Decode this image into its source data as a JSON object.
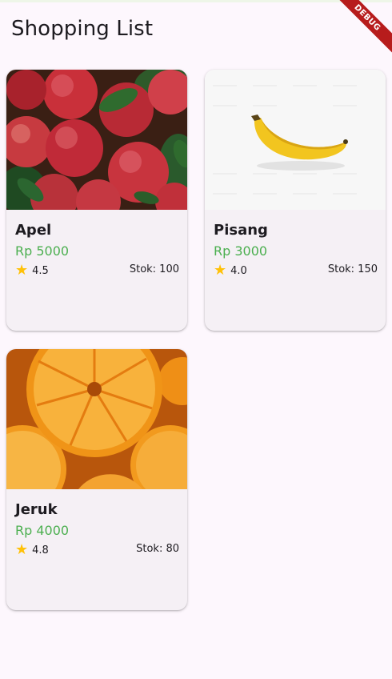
{
  "app": {
    "title": "Shopping List",
    "debug_label": "DEBUG"
  },
  "products": [
    {
      "name": "Apel",
      "price": "Rp 5000",
      "rating": "4.5",
      "stock": "Stok: 100",
      "image": "apples-photo"
    },
    {
      "name": "Pisang",
      "price": "Rp 3000",
      "rating": "4.0",
      "stock": "Stok: 150",
      "image": "banana-photo"
    },
    {
      "name": "Jeruk",
      "price": "Rp 4000",
      "rating": "4.8",
      "stock": "Stok: 80",
      "image": "orange-slices-photo"
    }
  ],
  "colors": {
    "price": "#4caf50",
    "star": "#ffc107",
    "background": "#fdf7fd",
    "card": "#f5f0f5",
    "debug_ribbon": "#b71c1c"
  },
  "icons": {
    "rating": "star-icon"
  }
}
